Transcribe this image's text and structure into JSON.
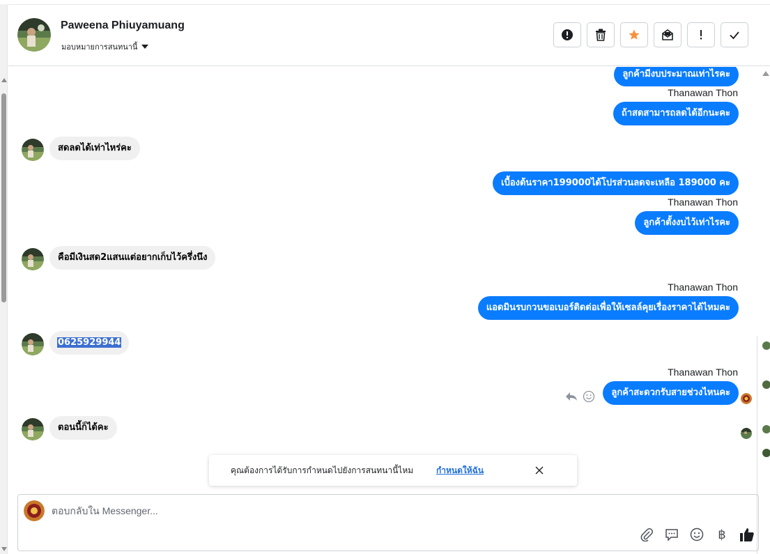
{
  "header": {
    "contact_name": "Paweena Phiuyamuang",
    "assign_label": "มอบหมายการสนทนานี้",
    "actions": [
      {
        "name": "spam-button",
        "icon": "exclamation-circle-icon"
      },
      {
        "name": "delete-button",
        "icon": "trash-icon"
      },
      {
        "name": "star-button",
        "icon": "star-icon"
      },
      {
        "name": "mark-unread-button",
        "icon": "envelope-icon"
      },
      {
        "name": "flag-button",
        "icon": "exclamation-icon"
      },
      {
        "name": "done-button",
        "icon": "check-icon"
      }
    ]
  },
  "messages": [
    {
      "dir": "out",
      "text": "ลูกค้ามีงบประมาณเท่าไรคะ"
    },
    {
      "dir": "out",
      "sender": "Thanawan Thon",
      "text": "ถ้าสดสามารถลดได้อีกนะคะ"
    },
    {
      "dir": "in",
      "text": "สดลดได้เท่าไหร่คะ"
    },
    {
      "dir": "out",
      "text": "เบื้องต้นราคา199000ได้โปรส่วนลดจะเหลือ 189000 คะ"
    },
    {
      "dir": "out",
      "sender": "Thanawan Thon",
      "text": "ลูกค้าตั้งงบไว้เท่าไรคะ"
    },
    {
      "dir": "in",
      "text": "คือมีเงินสด2แสนแต่อยากเก็บไว้ครึ่งนึง"
    },
    {
      "dir": "out",
      "sender": "Thanawan Thon",
      "text": "แอดมินรบกวนขอเบอร์ติดต่อเพื่อให้เซลล์คุยเรื่องราคาได้ไหมคะ"
    },
    {
      "dir": "in",
      "text": "0625929944",
      "selected": true
    },
    {
      "dir": "out",
      "sender": "Thanawan Thon",
      "text": "ลูกค้าสะดวกรับสายช่วงไหนคะ"
    },
    {
      "dir": "in",
      "text": "ตอนนี้ก็ได้คะ"
    }
  ],
  "notice": {
    "text": "คุณต้องการได้รับการกำหนดไปยังการสนทนานี้ไหม",
    "link": "กำหนดให้ฉัน"
  },
  "composer": {
    "placeholder": "ตอบกลับใน Messenger...",
    "tools": [
      "paperclip-icon",
      "saved-reply-icon",
      "emoji-icon",
      "baht-icon",
      "thumbs-up-icon"
    ],
    "baht_symbol": "฿"
  },
  "colors": {
    "outgoing_bubble": "#0a7cff",
    "incoming_bubble": "#f0f0f0",
    "star": "#f7923b",
    "link": "#216fdb"
  }
}
